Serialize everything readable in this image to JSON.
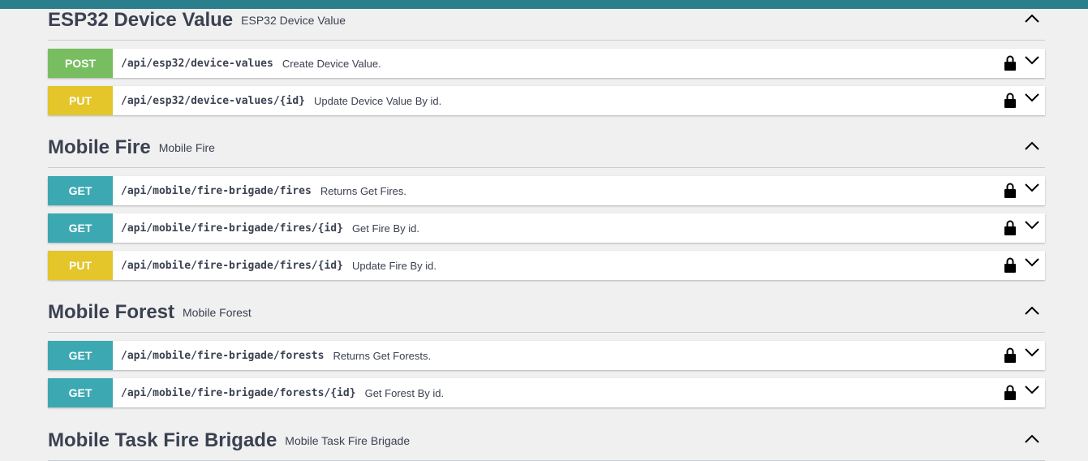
{
  "colors": {
    "topbar": "#2b7f8c",
    "POST": "#78be60",
    "PUT": "#e4c52a",
    "GET": "#3ca9b2",
    "background": "#f0f0f0"
  },
  "icons": {
    "lock": "lock-icon",
    "expand": "chevron-down-icon",
    "collapse": "chevron-up-icon"
  },
  "sections": [
    {
      "title": "ESP32 Device Value",
      "description": "ESP32 Device Value",
      "operations": [
        {
          "method": "POST",
          "path": "/api/esp32/device-values",
          "summary": "Create Device Value."
        },
        {
          "method": "PUT",
          "path": "/api/esp32/device-values/{id}",
          "summary": "Update Device Value By id."
        }
      ]
    },
    {
      "title": "Mobile Fire",
      "description": "Mobile Fire",
      "operations": [
        {
          "method": "GET",
          "path": "/api/mobile/fire-brigade/fires",
          "summary": "Returns Get Fires."
        },
        {
          "method": "GET",
          "path": "/api/mobile/fire-brigade/fires/{id}",
          "summary": "Get Fire By id."
        },
        {
          "method": "PUT",
          "path": "/api/mobile/fire-brigade/fires/{id}",
          "summary": "Update Fire By id."
        }
      ]
    },
    {
      "title": "Mobile Forest",
      "description": "Mobile Forest",
      "operations": [
        {
          "method": "GET",
          "path": "/api/mobile/fire-brigade/forests",
          "summary": "Returns Get Forests."
        },
        {
          "method": "GET",
          "path": "/api/mobile/fire-brigade/forests/{id}",
          "summary": "Get Forest By id."
        }
      ]
    },
    {
      "title": "Mobile Task Fire Brigade",
      "description": "Mobile Task Fire Brigade",
      "operations": []
    }
  ]
}
